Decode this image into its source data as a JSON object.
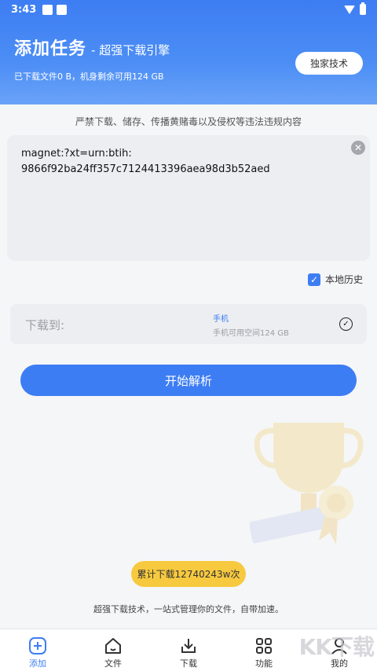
{
  "status_bar": {
    "time": "3:43"
  },
  "header": {
    "title": "添加任务",
    "subtitle": "- 超强下载引擎",
    "storage_info": "已下载文件0 B，机身剩余可用124 GB",
    "tech_button": "独家技术"
  },
  "notice": "严禁下载、储存、传播黄赌毒以及侵权等违法违规内容",
  "input": {
    "value": "magnet:?xt=urn:btih:\n9866f92ba24ff357c7124413396aea98d3b52aed"
  },
  "history": {
    "label": "本地历史",
    "checked": true
  },
  "download_to": {
    "label": "下载到:",
    "device": "手机",
    "space": "手机可用空间124 GB"
  },
  "parse_button": "开始解析",
  "stat_pill": "累计下载12740243w次",
  "slogan": "超强下载技术，一站式管理你的文件，自带加速。",
  "nav": [
    {
      "label": "添加",
      "icon": "add-task-icon",
      "active": true
    },
    {
      "label": "文件",
      "icon": "home-icon",
      "active": false
    },
    {
      "label": "下载",
      "icon": "download-icon",
      "active": false
    },
    {
      "label": "功能",
      "icon": "grid-icon",
      "active": false
    },
    {
      "label": "我的",
      "icon": "profile-icon",
      "active": false
    }
  ],
  "watermark": "KK下载",
  "colors": {
    "accent": "#3d7df3",
    "pill": "#f7c93f"
  }
}
